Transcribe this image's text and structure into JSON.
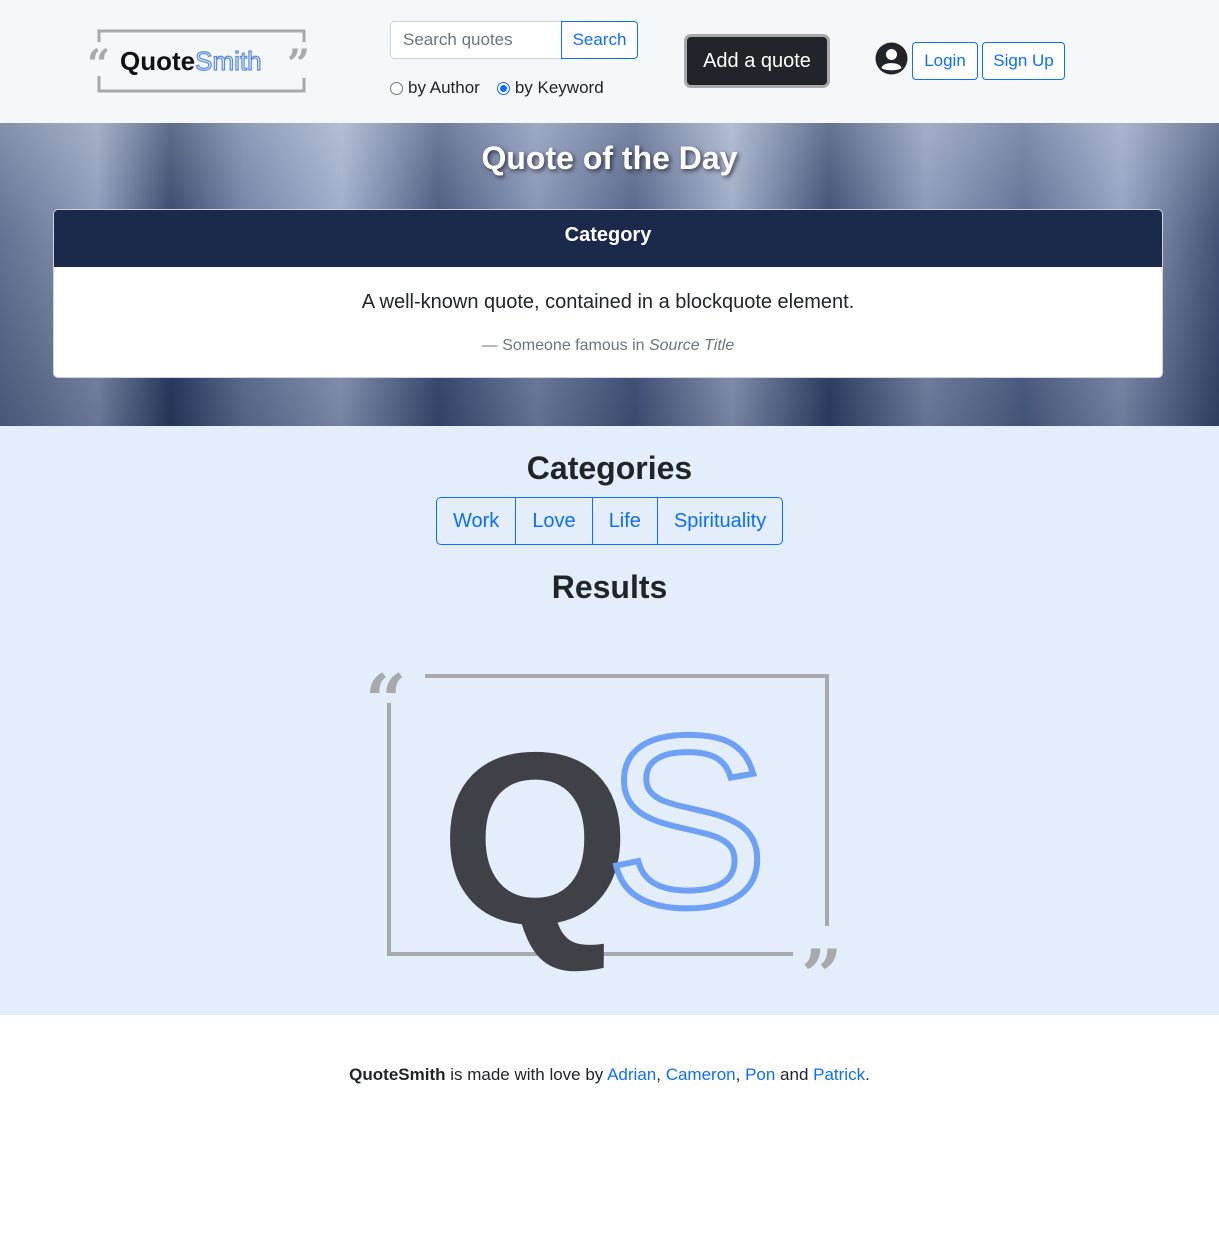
{
  "header": {
    "logo": {
      "brand_part1": "Quote",
      "brand_part2": "Smith",
      "icon": "quote-frame-logo"
    },
    "search": {
      "placeholder": "Search quotes",
      "value": "",
      "button_label": "Search"
    },
    "search_mode": {
      "options": [
        "by Author",
        "by Keyword"
      ],
      "selected": "by Keyword"
    },
    "add_quote_label": "Add a quote",
    "user_icon": "user-circle-icon",
    "login_label": "Login",
    "signup_label": "Sign Up"
  },
  "hero": {
    "title": "Quote of the Day",
    "card": {
      "category": "Category",
      "quote": "A well-known quote, contained in a blockquote element.",
      "attribution_prefix": "— Someone famous in ",
      "source_title": "Source Title"
    }
  },
  "main": {
    "categories_title": "Categories",
    "categories": [
      "Work",
      "Love",
      "Life",
      "Spirituality"
    ],
    "results_title": "Results",
    "results_logo": {
      "letters_dark": "Q",
      "letters_outline": "S",
      "icon": "qs-logo"
    }
  },
  "footer": {
    "brand": "QuoteSmith",
    "text_made": " is made with love by ",
    "authors": [
      "Adrian",
      "Cameron",
      "Pon",
      "Patrick"
    ],
    "sep_comma": ", ",
    "sep_and": " and ",
    "end": "."
  },
  "colors": {
    "accent": "#0d6efd",
    "header_bg": "#f6f7f9",
    "card_header": "#1b2a4a",
    "main_bg": "#e4eefa",
    "logo_dark": "#3f4146",
    "logo_blue": "#6ea1f5",
    "logo_gray": "#a7a9ac"
  }
}
